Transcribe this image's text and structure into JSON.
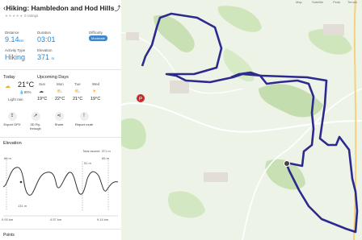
{
  "header": {
    "title": "Hiking: Hambledon and Hod Hills",
    "ratings": "0 ratings"
  },
  "stats": {
    "distance_label": "Distance",
    "distance_value": "9.14",
    "distance_unit": "km",
    "duration_label": "Duration",
    "duration_value": "03:01",
    "difficulty_label": "Difficulty",
    "difficulty_value": "Moderate",
    "activity_label": "Activity Type",
    "activity_value": "Hiking",
    "elevation_label": "Elevation",
    "elevation_value": "371",
    "elevation_unit": "m"
  },
  "weather": {
    "today_label": "Today",
    "today_temp": "21°C",
    "today_precip": "80%",
    "today_desc": "Light rain",
    "upcoming_label": "Upcoming Days",
    "days": [
      {
        "day": "Sun",
        "temp": "19°C"
      },
      {
        "day": "Mon",
        "temp": "22°C"
      },
      {
        "day": "Tue",
        "temp": "21°C"
      },
      {
        "day": "Wed",
        "temp": "19°C"
      }
    ]
  },
  "actions": [
    {
      "label": "Export GPX",
      "icon": "export-icon"
    },
    {
      "label": "3D Fly-through",
      "icon": "flythrough-icon"
    },
    {
      "label": "Share",
      "icon": "share-icon"
    },
    {
      "label": "Report route",
      "icon": "report-icon"
    }
  ],
  "elevation": {
    "label": "Elevation",
    "total_ascent": "Total ascent: 371 m",
    "labels": {
      "start": "66 m",
      "low": "131 m",
      "mid": "51 m",
      "end": "65 m"
    },
    "x_labels": [
      "0.00 km",
      "4.57 km",
      "9.14 km"
    ]
  },
  "points_label": "Points",
  "map": {
    "tabs": [
      "Map",
      "Satellite",
      "Peak",
      "Terrain"
    ]
  },
  "colors": {
    "accent": "#1e88d6",
    "route": "#2d2a8f"
  }
}
